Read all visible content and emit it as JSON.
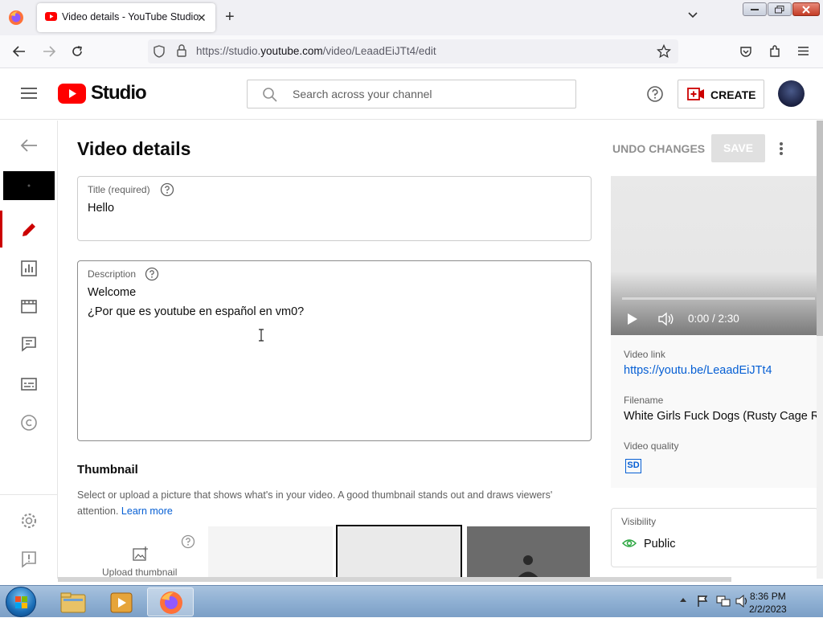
{
  "browser": {
    "tab_title": "Video details - YouTube Studio",
    "url_prefix": "https://studio.",
    "url_domain": "youtube.com",
    "url_path": "/video/LeaadEiJTt4/edit"
  },
  "header": {
    "brand": "Studio",
    "search_placeholder": "Search across your channel",
    "create_label": "CREATE"
  },
  "page": {
    "title": "Video details",
    "undo_label": "UNDO CHANGES",
    "save_label": "SAVE"
  },
  "form": {
    "title_label": "Title (required)",
    "title_value": "Hello",
    "description_label": "Description",
    "description_line1": "Welcome",
    "description_line2": "¿Por que es youtube en español en vm0?"
  },
  "thumbnail": {
    "heading": "Thumbnail",
    "description": "Select or upload a picture that shows what's in your video. A good thumbnail stands out and draws viewers' attention.",
    "learn_more": "Learn more",
    "upload_label": "Upload thumbnail"
  },
  "player": {
    "time": "0:00 / 2:30"
  },
  "info": {
    "video_link_label": "Video link",
    "video_link": "https://youtu.be/LeaadEiJTt4",
    "filename_label": "Filename",
    "filename": "White Girls Fuck Dogs (Rusty Cage R",
    "quality_label": "Video quality",
    "quality_badge": "SD"
  },
  "visibility": {
    "label": "Visibility",
    "value": "Public"
  },
  "taskbar": {
    "time": "8:36 PM",
    "date": "2/2/2023"
  },
  "colors": {
    "brand_red": "#ff0000",
    "link_blue": "#065fd4",
    "active_red": "#cc0000",
    "visibility_green": "#2ba640"
  }
}
